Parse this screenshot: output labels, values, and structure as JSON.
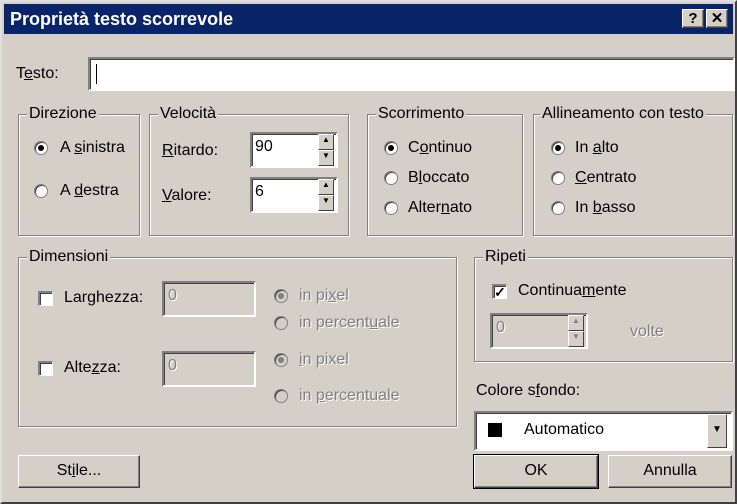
{
  "window": {
    "title": "Proprietà testo scorrevole",
    "help_btn": "?",
    "close_btn": "✕"
  },
  "text_field": {
    "label_pre": "T",
    "label_ul": "e",
    "label_post": "sto:",
    "value": ""
  },
  "direzione": {
    "legend": "Direzione",
    "options": [
      {
        "pre": "A ",
        "ul": "s",
        "post": "inistra",
        "checked": true
      },
      {
        "pre": "A ",
        "ul": "d",
        "post": "estra",
        "checked": false
      }
    ]
  },
  "velocita": {
    "legend": "Velocità",
    "ritardo": {
      "pre": "",
      "ul": "R",
      "post": "itardo:",
      "value": "90"
    },
    "valore": {
      "pre": "",
      "ul": "V",
      "post": "alore:",
      "value": "6"
    }
  },
  "scorrimento": {
    "legend": "Scorrimento",
    "options": [
      {
        "pre": "C",
        "ul": "o",
        "post": "ntinuo",
        "checked": true
      },
      {
        "pre": "B",
        "ul": "l",
        "post": "occato",
        "checked": false
      },
      {
        "pre": "Alter",
        "ul": "n",
        "post": "ato",
        "checked": false
      }
    ]
  },
  "allineamento": {
    "legend": "Allineamento con testo",
    "options": [
      {
        "pre": "In ",
        "ul": "a",
        "post": "lto",
        "checked": true
      },
      {
        "pre": "",
        "ul": "C",
        "post": "entrato",
        "checked": false
      },
      {
        "pre": "In ",
        "ul": "b",
        "post": "asso",
        "checked": false
      }
    ]
  },
  "dimensioni": {
    "legend": "Dimensioni",
    "larghezza": {
      "pre": "Lar",
      "ul": "g",
      "post": "hezza:",
      "value": "0",
      "checked": false,
      "unit_pixel": {
        "pre": "in pi",
        "ul": "x",
        "post": "el"
      },
      "unit_percent": {
        "pre": "in percent",
        "ul": "u",
        "post": "ale"
      }
    },
    "altezza": {
      "pre": "Alte",
      "ul": "z",
      "post": "za:",
      "value": "0",
      "checked": false,
      "unit_pixel": {
        "pre": "",
        "ul": "i",
        "post": "n pixel"
      },
      "unit_percent": {
        "pre": "in ",
        "ul": "p",
        "post": "ercentuale"
      }
    }
  },
  "ripeti": {
    "legend": "Ripeti",
    "continuamente": {
      "pre": "Continua",
      "ul": "m",
      "post": "ente",
      "checked": true
    },
    "count_value": "0",
    "volte": "volte"
  },
  "colore": {
    "label_pre": "Colore s",
    "label_ul": "f",
    "label_post": "ondo:",
    "value": "Automatico",
    "swatch": "#000000"
  },
  "buttons": {
    "stile": {
      "pre": "St",
      "ul": "i",
      "post": "le..."
    },
    "ok": "OK",
    "annulla": "Annulla"
  }
}
